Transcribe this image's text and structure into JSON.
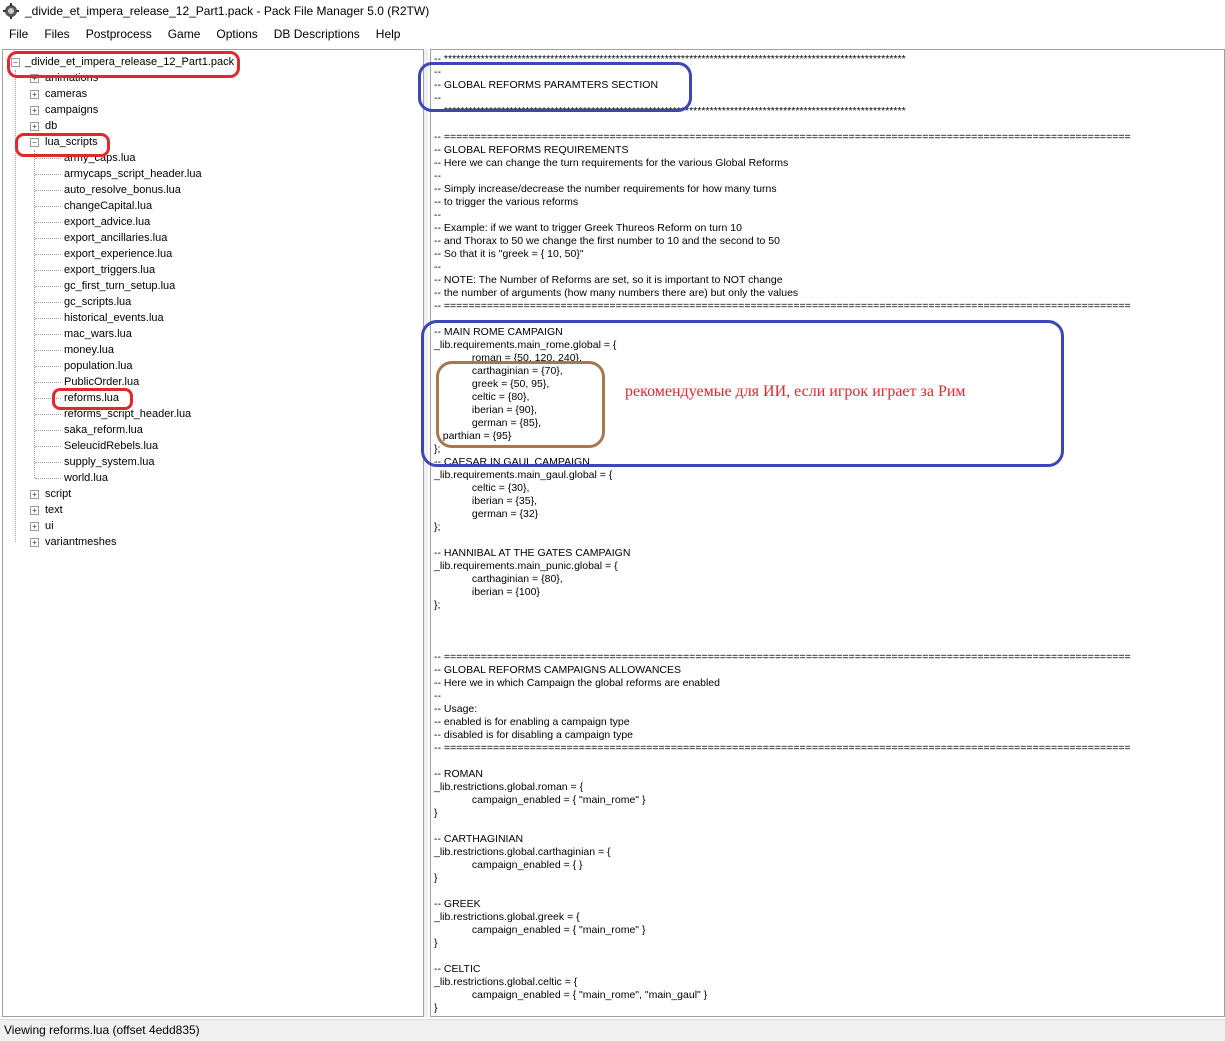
{
  "window": {
    "title": "_divide_et_impera_release_12_Part1.pack - Pack File Manager 5.0 (R2TW)",
    "icon": "gear-icon"
  },
  "menu": [
    "File",
    "Files",
    "Postprocess",
    "Game",
    "Options",
    "DB Descriptions",
    "Help"
  ],
  "tree": {
    "root": "_divide_et_impera_release_12_Part1.pack",
    "folders_top": [
      "animations",
      "cameras",
      "campaigns",
      "db",
      "lua_scripts"
    ],
    "lua_files": [
      "army_caps.lua",
      "armycaps_script_header.lua",
      "auto_resolve_bonus.lua",
      "changeCapital.lua",
      "export_advice.lua",
      "export_ancillaries.lua",
      "export_experience.lua",
      "export_triggers.lua",
      "gc_first_turn_setup.lua",
      "gc_scripts.lua",
      "historical_events.lua",
      "mac_wars.lua",
      "money.lua",
      "population.lua",
      "PublicOrder.lua",
      "reforms.lua",
      "reforms_script_header.lua",
      "saka_reform.lua",
      "SeleucidRebels.lua",
      "supply_system.lua",
      "world.lua"
    ],
    "folders_bottom": [
      "script",
      "text",
      "ui",
      "variantmeshes"
    ]
  },
  "editor": {
    "lines": [
      "-- *****************************************************************************************************************",
      "--",
      "-- GLOBAL REFORMS PARAMTERS SECTION",
      "--",
      "-- *****************************************************************************************************************",
      "",
      "-- ================================================================================================================",
      "-- GLOBAL REFORMS REQUIREMENTS",
      "-- Here we can change the turn requirements for the various Global Reforms",
      "--",
      "-- Simply increase/decrease the number requirements for how many turns",
      "-- to trigger the various reforms",
      "--",
      "-- Example: if we want to trigger Greek Thureos Reform on turn 10",
      "-- and Thorax to 50 we change the first number to 10 and the second to 50",
      "-- So that it is \"greek = { 10, 50}\"",
      "--",
      "-- NOTE: The Number of Reforms are set, so it is important to NOT change",
      "-- the number of arguments (how many numbers there are) but only the values",
      "-- ================================================================================================================",
      "",
      "-- MAIN ROME CAMPAIGN",
      "_lib.requirements.main_rome.global = {",
      "             roman = {50, 120, 240},",
      "             carthaginian = {70},",
      "             greek = {50, 95},",
      "             celtic = {80},",
      "             iberian = {90},",
      "             german = {85},",
      "   parthian = {95}",
      "};",
      "-- CAESAR IN GAUL CAMPAIGN",
      "_lib.requirements.main_gaul.global = {",
      "             celtic = {30},",
      "             iberian = {35},",
      "             german = {32}",
      "};",
      "",
      "-- HANNIBAL AT THE GATES CAMPAIGN",
      "_lib.requirements.main_punic.global = {",
      "             carthaginian = {80},",
      "             iberian = {100}",
      "};",
      "",
      "",
      "",
      "-- ================================================================================================================",
      "-- GLOBAL REFORMS CAMPAIGNS ALLOWANCES",
      "-- Here we in which Campaign the global reforms are enabled",
      "--",
      "-- Usage:",
      "-- enabled is for enabling a campaign type",
      "-- disabled is for disabling a campaign type",
      "-- ================================================================================================================",
      "",
      "-- ROMAN",
      "_lib.restrictions.global.roman = {",
      "             campaign_enabled = { \"main_rome\" }",
      "}",
      "",
      "-- CARTHAGINIAN",
      "_lib.restrictions.global.carthaginian = {",
      "             campaign_enabled = { }",
      "}",
      "",
      "-- GREEK",
      "_lib.restrictions.global.greek = {",
      "             campaign_enabled = { \"main_rome\" }",
      "}",
      "",
      "-- CELTIC",
      "_lib.restrictions.global.celtic = {",
      "             campaign_enabled = { \"main_rome\", \"main_gaul\" }",
      "}"
    ]
  },
  "annotation": {
    "note": "рекомендуемые для ИИ, если игрок играет за Рим",
    "colors": {
      "red": "#e0282e",
      "blue": "#3c46b4",
      "brown": "#a67850"
    }
  },
  "status": "Viewing reforms.lua (offset 4edd835)"
}
